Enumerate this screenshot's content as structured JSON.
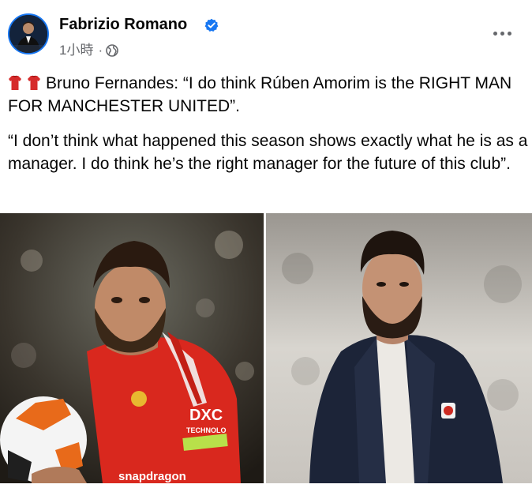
{
  "post": {
    "author": {
      "name": "Fabrizio Romano",
      "verified_icon": "verified-badge-icon",
      "verified_color": "#1877f2"
    },
    "timestamp": "1小時",
    "separator": "·",
    "audience_icon": "globe-icon",
    "more_icon": "more-options-icon",
    "text": {
      "line1": "Bruno Fernandes: “I do think Rúben Amorim is the RIGHT MAN FOR MANCHESTER UNITED”.",
      "line2": "“I don’t think what happened this season shows exactly what he is as a manager. I do think he’s the right manager for the future of this club”.",
      "emoji": [
        "red-shirt-icon",
        "red-shirt-icon"
      ]
    },
    "images": [
      {
        "name": "photo-bruno-fernandes",
        "kit_text": "TECHNOLO",
        "sponsor_text": "snapdragon"
      },
      {
        "name": "photo-ruben-amorim"
      }
    ]
  }
}
